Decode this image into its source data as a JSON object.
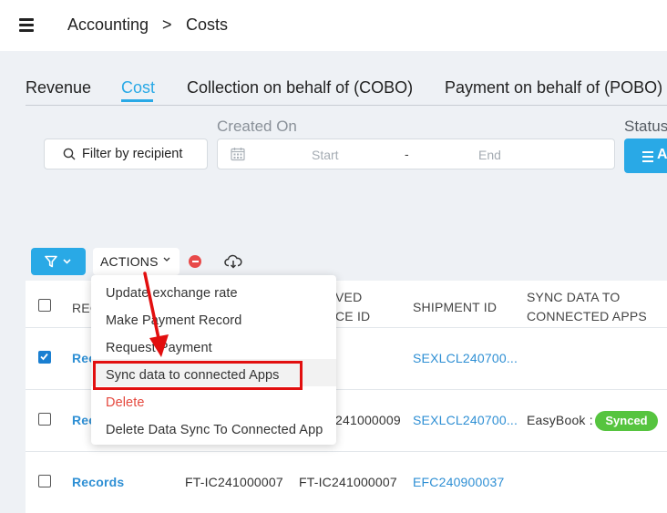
{
  "breadcrumb": {
    "parent": "Accounting",
    "separator": ">",
    "current": "Costs"
  },
  "tabs": [
    {
      "label": "Revenue",
      "active": false
    },
    {
      "label": "Cost",
      "active": true
    },
    {
      "label": "Collection on behalf of (COBO)",
      "active": false
    },
    {
      "label": "Payment on behalf of (POBO)",
      "active": false
    }
  ],
  "filters": {
    "recipient_button": "Filter by recipient",
    "created_on_label": "Created On",
    "date_start_placeholder": "Start",
    "date_separator": "-",
    "date_end_placeholder": "End",
    "status_label": "Status",
    "status_button": "A"
  },
  "toolbar": {
    "actions_label": "ACTIONS"
  },
  "actions_menu": [
    {
      "label": "Update exchange rate"
    },
    {
      "label": "Make Payment Record"
    },
    {
      "label": "Request Payment"
    },
    {
      "label": "Sync data to connected Apps",
      "highlighted": true
    },
    {
      "label": "Delete",
      "danger": true
    },
    {
      "label": "Delete Data Sync To Connected App"
    }
  ],
  "table": {
    "headers": {
      "record": "REC",
      "received_invoice_line1": "VED",
      "received_invoice_line2": "CE ID",
      "shipment_id": "SHIPMENT ID",
      "sync_line1": "SYNC DATA TO",
      "sync_line2": "CONNECTED APPS"
    },
    "rows": [
      {
        "checked": true,
        "record": "Reco",
        "col2": "",
        "col3": "",
        "shipment": "SEXLCL240700...",
        "sync_app": "",
        "sync_status": ""
      },
      {
        "checked": false,
        "record": "Rec",
        "col2": "",
        "col3": "241000009",
        "shipment": "SEXLCL240700...",
        "sync_app": "EasyBook :",
        "sync_status": "Synced"
      },
      {
        "checked": false,
        "record": "Records",
        "col2": "FT-IC241000007",
        "col3": "FT-IC241000007",
        "shipment": "EFC240900037",
        "sync_app": "",
        "sync_status": ""
      }
    ]
  },
  "colors": {
    "accent": "#29a9e6",
    "danger": "#e5493f",
    "success": "#56c43f",
    "annotation": "#e20f0f"
  },
  "icons": [
    "hamburger-icon",
    "search-icon",
    "calendar-icon",
    "filter-funnel-icon",
    "chevron-down-icon",
    "remove-circle-icon",
    "cloud-download-icon",
    "list-icon"
  ]
}
